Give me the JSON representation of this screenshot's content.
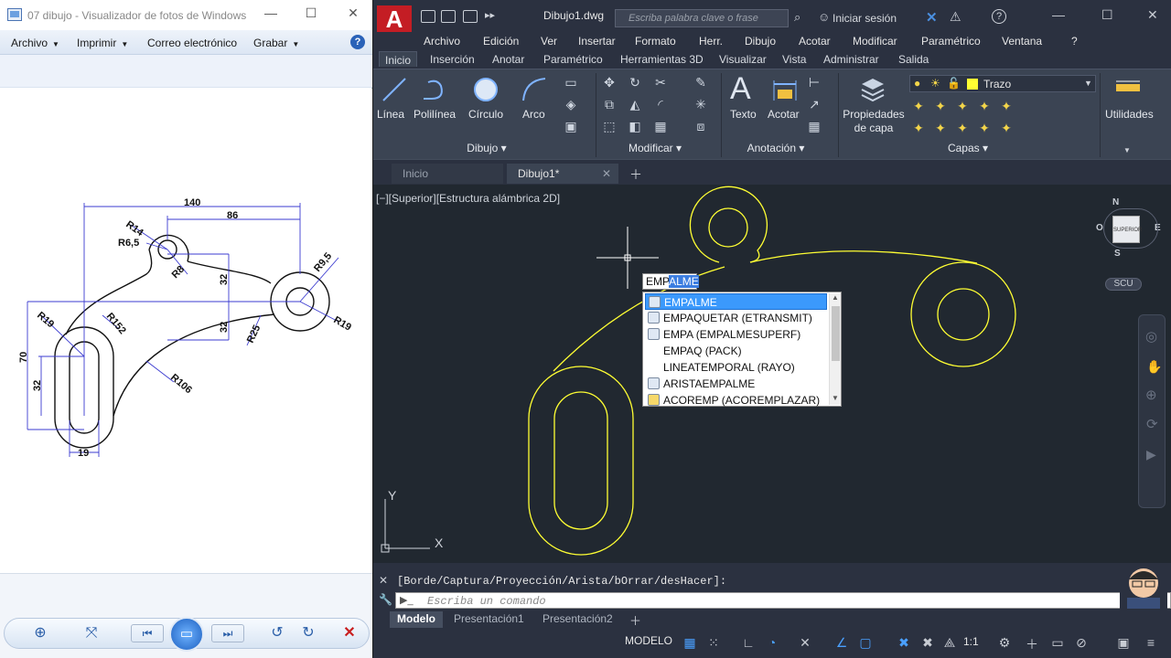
{
  "viewer": {
    "title": "07 dibujo - Visualizador de fotos de Windows",
    "menu": [
      "Archivo",
      "Imprimir",
      "Correo electrónico",
      "Grabar"
    ],
    "dims": {
      "d140": "140",
      "d86": "86",
      "r14": "R14",
      "r65": "R6,5",
      "r8": "R8",
      "d32a": "32",
      "r95": "R9,5",
      "r19a": "R19",
      "r152": "R152",
      "d32b": "32",
      "r25": "R25",
      "r19b": "R19",
      "d70": "70",
      "d32c": "32",
      "r106": "R106",
      "d19": "19"
    }
  },
  "autocad": {
    "file_title": "Dibujo1.dwg",
    "search_placeholder": "Escriba palabra clave o frase",
    "login": "Iniciar sesión",
    "menubar": [
      "Archivo",
      "Edición",
      "Ver",
      "Insertar",
      "Formato",
      "Herr.",
      "Dibujo",
      "Acotar",
      "Modificar",
      "Paramétrico",
      "Ventana",
      "?"
    ],
    "ribbon_tabs": [
      "Inicio",
      "Inserción",
      "Anotar",
      "Paramétrico",
      "Herramientas 3D",
      "Visualizar",
      "Vista",
      "Administrar",
      "Salida"
    ],
    "draw_tools": [
      "Línea",
      "Polilínea",
      "Círculo",
      "Arco"
    ],
    "annot_tools": [
      "Texto",
      "Acotar"
    ],
    "layer_props": "Propiedades de capa",
    "layer_name": "Trazo",
    "utilities": "Utilidades",
    "panels": [
      "Dibujo",
      "Modificar",
      "Anotación",
      "Capas"
    ],
    "file_tabs": [
      "Inicio",
      "Dibujo1*"
    ],
    "viewport_label": "[−][Superior][Estructura alámbrica 2D]",
    "viewcube": {
      "n": "N",
      "s": "S",
      "e": "E",
      "o": "O",
      "face": "SUPERIOR",
      "scu": "SCU"
    },
    "ucs": {
      "x": "X",
      "y": "Y"
    },
    "cmd_input_typed": "EMP",
    "cmd_input_suggest": "ALME",
    "autocomplete": [
      "EMPALME",
      "EMPAQUETAR (ETRANSMIT)",
      "EMPA (EMPALMESUPERF)",
      "EMPAQ (PACK)",
      "LINEATEMPORAL (RAYO)",
      "ARISTAEMPALME",
      "ACOREMP (ACOREMPLAZAR)"
    ],
    "cmd_history": "[Borde/Captura/Proyección/Arista/bOrrar/desHacer]:",
    "cmd_placeholder": "Escriba un comando",
    "layout_tabs": [
      "Modelo",
      "Presentación1",
      "Presentación2"
    ],
    "status_model": "MODELO",
    "status_scale": "1:1"
  },
  "colors": {
    "drawing": "#ffff33",
    "dim": "#3b3bd0",
    "accent": "#3b99fc",
    "acad_red": "#c41d24"
  }
}
